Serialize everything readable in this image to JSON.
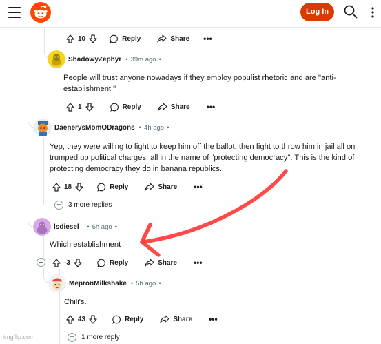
{
  "header": {
    "login_label": "Log In",
    "menu_icon": "hamburger-icon",
    "logo_icon": "reddit-logo-icon",
    "search_icon": "search-icon",
    "more_icon": "more-vertical-icon",
    "brand_color": "#d93a00"
  },
  "top_actions": {
    "votes": "10",
    "reply": "Reply",
    "share": "Share",
    "more": "•••"
  },
  "comments": [
    {
      "username": "ShadowyZephyr",
      "time": "39m ago",
      "body": "People will trust anyone nowadays if they employ populist rhetoric and are \"anti-establishment.\"",
      "votes": "1",
      "reply": "Reply",
      "share": "Share",
      "more": "•••"
    },
    {
      "username": "DaenerysMomODragons",
      "time": "4h ago",
      "body": "Yep, they were willing to fight to keep him off the ballot, then fight to throw him in jail all on trumped up political charges, all in the name of \"protecting democracy\". This is the kind of protecting democracy they do in banana republics.",
      "votes": "18",
      "reply": "Reply",
      "share": "Share",
      "more": "•••",
      "more_replies": "3 more replies"
    },
    {
      "username": "lsdiesel_",
      "time": "6h ago",
      "body": "Which establishment",
      "votes": "-3",
      "reply": "Reply",
      "share": "Share",
      "more": "•••"
    },
    {
      "username": "MepronMilkshake",
      "time": "5h ago",
      "body": "Chili's.",
      "votes": "43",
      "reply": "Reply",
      "share": "Share",
      "more": "•••",
      "more_replies": "1 more reply"
    }
  ],
  "separator": "•",
  "watermark": "imgflip.com",
  "annotation": {
    "type": "hand-drawn-arrow",
    "color": "#ff3b3b"
  }
}
